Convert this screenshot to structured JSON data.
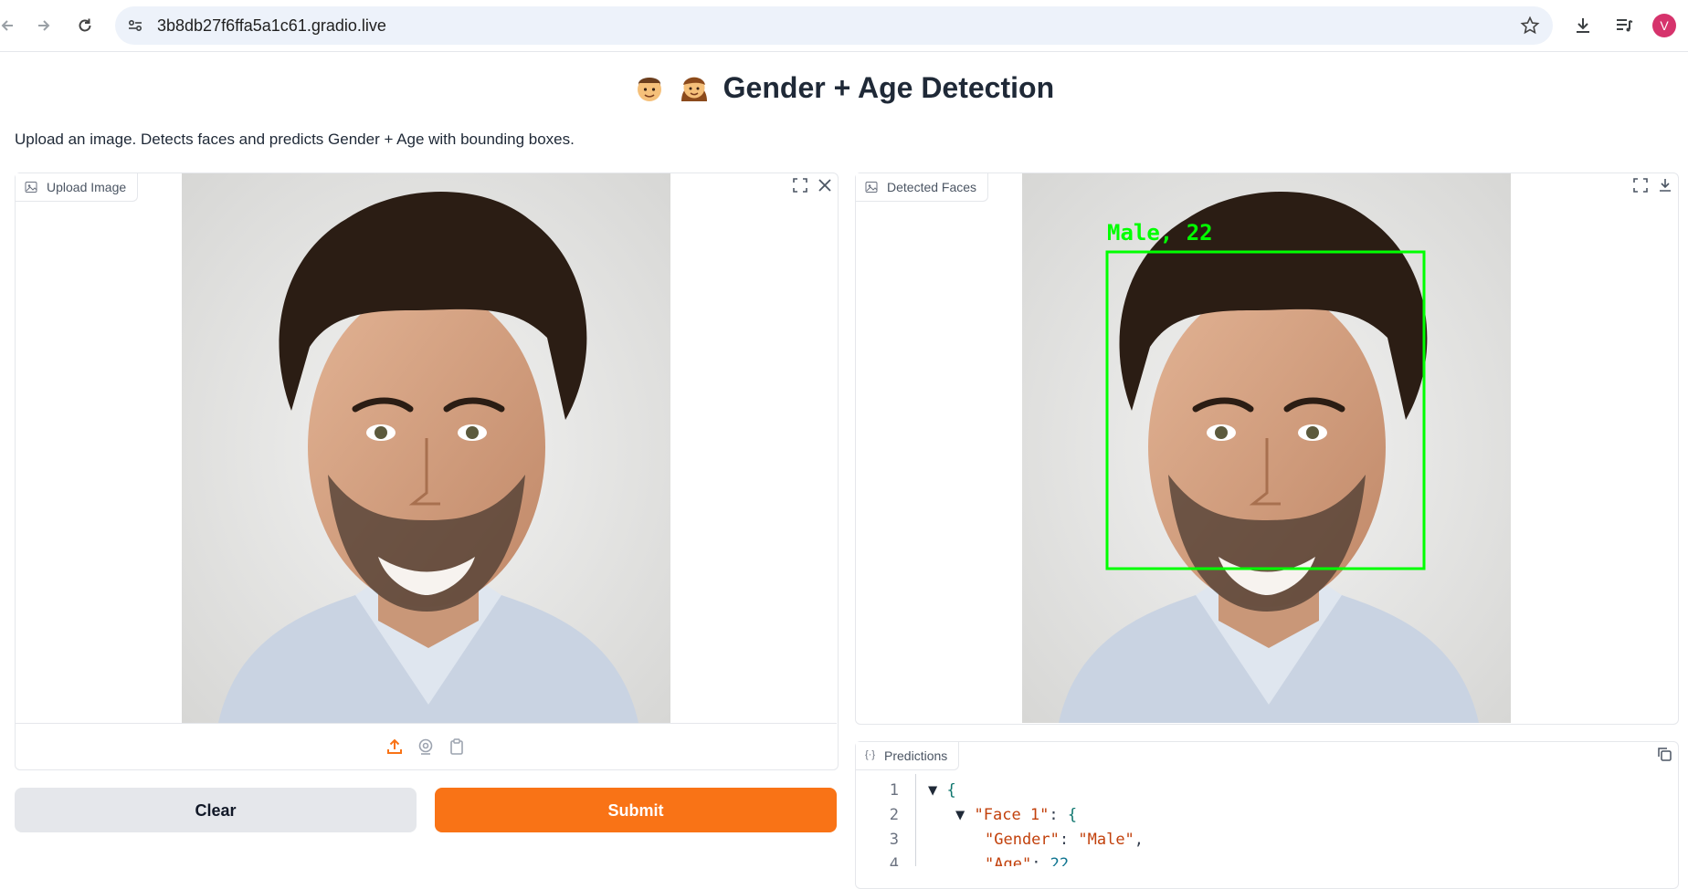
{
  "browser": {
    "url": "3b8db27f6ffa5a1c61.gradio.live",
    "avatar_letter": "V"
  },
  "page": {
    "title": "Gender + Age Detection",
    "title_emojis": [
      "man-emoji",
      "woman-emoji"
    ],
    "description": "Upload an image. Detects faces and predicts Gender + Age with bounding boxes."
  },
  "input_panel": {
    "label": "Upload Image",
    "source_icons": [
      "upload-icon",
      "webcam-icon",
      "clipboard-icon"
    ]
  },
  "output_panel": {
    "label": "Detected Faces",
    "detection_label": "Male, 22",
    "box_color": "#00ff00"
  },
  "buttons": {
    "clear": "Clear",
    "submit": "Submit"
  },
  "predictions": {
    "label": "Predictions",
    "line_numbers": [
      "1",
      "2",
      "3",
      "4"
    ],
    "brace_open": "{",
    "face_key": "\"Face 1\"",
    "gender_key": "\"Gender\"",
    "gender_value": "\"Male\"",
    "age_key": "\"Age\"",
    "age_value": "22"
  },
  "colors": {
    "accent": "#f97316",
    "secondary_button": "#e5e7eb"
  }
}
